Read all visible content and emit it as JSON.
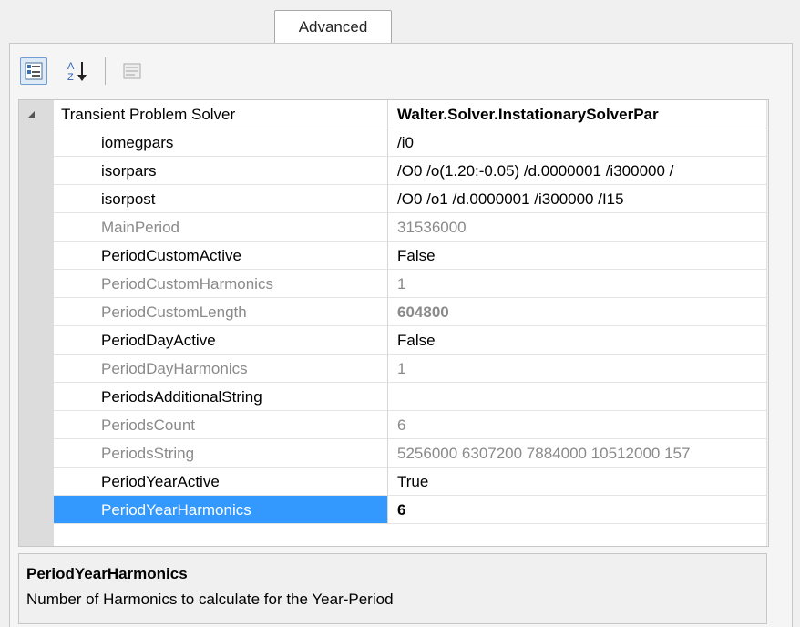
{
  "tabs": [
    {
      "label": "Advanced",
      "selected": true
    }
  ],
  "toolbar": {
    "categorized_icon": "categorized-view-icon",
    "alphabetical_icon": "sort-alphabetical-icon",
    "property_pages_icon": "property-pages-icon"
  },
  "grid": {
    "category": {
      "name": "Transient Problem Solver",
      "value": "Walter.Solver.InstationarySolverPar",
      "expanded": true
    },
    "rows": [
      {
        "name": "iomegpars",
        "value": "/i0",
        "readonly": false
      },
      {
        "name": "isorpars",
        "value": "/O0 /o(1.20:-0.05) /d.0000001 /i300000 /",
        "readonly": false
      },
      {
        "name": "isorpost",
        "value": "/O0 /o1 /d.0000001 /i300000 /I15",
        "readonly": false
      },
      {
        "name": "MainPeriod",
        "value": "31536000",
        "readonly": true
      },
      {
        "name": "PeriodCustomActive",
        "value": "False",
        "readonly": false
      },
      {
        "name": "PeriodCustomHarmonics",
        "value": "1",
        "readonly": true
      },
      {
        "name": "PeriodCustomLength",
        "value": "604800",
        "readonly": true,
        "bold": true
      },
      {
        "name": "PeriodDayActive",
        "value": "False",
        "readonly": false
      },
      {
        "name": "PeriodDayHarmonics",
        "value": "1",
        "readonly": true
      },
      {
        "name": "PeriodsAdditionalString",
        "value": "",
        "readonly": false
      },
      {
        "name": "PeriodsCount",
        "value": "6",
        "readonly": true
      },
      {
        "name": "PeriodsString",
        "value": "5256000 6307200 7884000 10512000 157",
        "readonly": true
      },
      {
        "name": "PeriodYearActive",
        "value": "True",
        "readonly": false
      },
      {
        "name": "PeriodYearHarmonics",
        "value": "6",
        "readonly": false,
        "bold": true,
        "selected": true
      }
    ]
  },
  "description": {
    "title": "PeriodYearHarmonics",
    "text": "Number of Harmonics to calculate for the Year-Period"
  },
  "colors": {
    "selection": "#3399ff",
    "readonly_text": "#8a8a8a"
  }
}
